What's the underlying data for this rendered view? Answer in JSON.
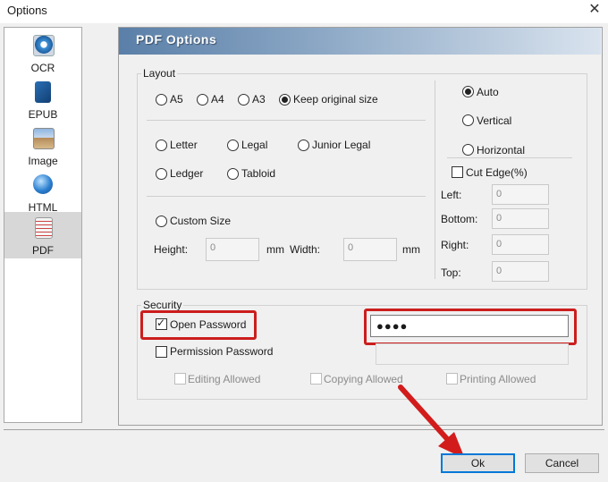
{
  "window": {
    "title": "Options",
    "close": "✕"
  },
  "sidebar": {
    "items": [
      {
        "label": "OCR"
      },
      {
        "label": "EPUB"
      },
      {
        "label": "Image"
      },
      {
        "label": "HTML"
      },
      {
        "label": "PDF",
        "selected": true
      }
    ]
  },
  "panel": {
    "title": "PDF Options"
  },
  "layout": {
    "group_label": "Layout",
    "sizes_row1": [
      "A5",
      "A4",
      "A3",
      "Keep original size"
    ],
    "sizes_row2": [
      "Letter",
      "Legal",
      "Junior Legal"
    ],
    "sizes_row3": [
      "Ledger",
      "Tabloid"
    ],
    "selected_size": "Keep original size",
    "custom_size_label": "Custom Size",
    "height_label": "Height:",
    "height_value": "0",
    "height_unit": "mm",
    "width_label": "Width:",
    "width_value": "0",
    "width_unit": "mm",
    "orientation": [
      "Auto",
      "Vertical",
      "Horizontal"
    ],
    "selected_orientation": "Auto",
    "cut_edge_label": "Cut Edge(%)",
    "left_label": "Left:",
    "left_value": "0",
    "bottom_label": "Bottom:",
    "bottom_value": "0",
    "right_label": "Right:",
    "right_value": "0",
    "top_label": "Top:",
    "top_value": "0"
  },
  "security": {
    "group_label": "Security",
    "open_password_label": "Open Password",
    "open_password_checked": true,
    "open_password_value": "●●●●",
    "permission_password_label": "Permission Password",
    "permission_password_checked": false,
    "editing_allowed": "Editing Allowed",
    "copying_allowed": "Copying Allowed",
    "printing_allowed": "Printing Allowed"
  },
  "buttons": {
    "ok": "Ok",
    "cancel": "Cancel"
  },
  "colors": {
    "highlight": "#cc1d1d",
    "default_button_border": "#0078d7"
  }
}
